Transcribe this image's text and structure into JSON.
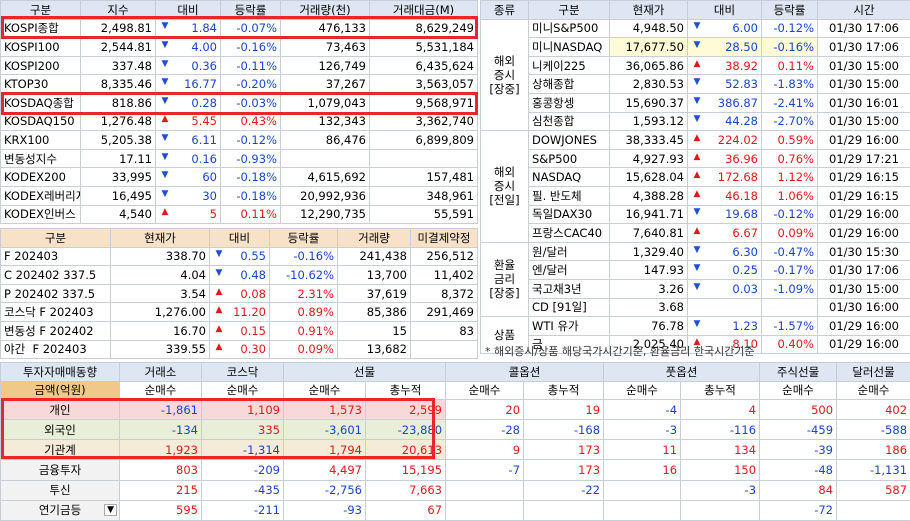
{
  "index_table": {
    "headers": [
      "구분",
      "지수",
      "대비",
      "등락률",
      "거래량(천)",
      "거래대금(M)"
    ],
    "rows": [
      {
        "name": "KOSPI종합",
        "value": "2,498.81",
        "dir": "dn",
        "change": "1.84",
        "rate": "-0.07%",
        "vol": "476,133",
        "amt": "8,629,249"
      },
      {
        "name": "KOSPI100",
        "value": "2,544.81",
        "dir": "dn",
        "change": "4.00",
        "rate": "-0.16%",
        "vol": "73,463",
        "amt": "5,531,184"
      },
      {
        "name": "KOSPI200",
        "value": "337.48",
        "dir": "dn",
        "change": "0.36",
        "rate": "-0.11%",
        "vol": "126,749",
        "amt": "6,435,624"
      },
      {
        "name": "KTOP30",
        "value": "8,335.46",
        "dir": "dn",
        "change": "16.77",
        "rate": "-0.20%",
        "vol": "37,267",
        "amt": "3,563,057"
      },
      {
        "name": "KOSDAQ종합",
        "value": "818.86",
        "dir": "dn",
        "change": "0.28",
        "rate": "-0.03%",
        "vol": "1,079,043",
        "amt": "9,568,971"
      },
      {
        "name": "KOSDAQ150",
        "value": "1,276.48",
        "dir": "up",
        "change": "5.45",
        "rate": "0.43%",
        "vol": "132,343",
        "amt": "3,362,740"
      },
      {
        "name": "KRX100",
        "value": "5,205.38",
        "dir": "dn",
        "change": "6.11",
        "rate": "-0.12%",
        "vol": "86,476",
        "amt": "6,899,809"
      },
      {
        "name": "변동성지수",
        "value": "17.11",
        "dir": "dn",
        "change": "0.16",
        "rate": "-0.93%",
        "vol": "",
        "amt": ""
      },
      {
        "name": "KODEX200",
        "value": "33,995",
        "dir": "dn",
        "change": "60",
        "rate": "-0.18%",
        "vol": "4,615,692",
        "amt": "157,481"
      },
      {
        "name": "KODEX레버리지",
        "value": "16,495",
        "dir": "dn",
        "change": "30",
        "rate": "-0.18%",
        "vol": "20,992,936",
        "amt": "348,961"
      },
      {
        "name": "KODEX인버스",
        "value": "4,540",
        "dir": "up",
        "change": "5",
        "rate": "0.11%",
        "vol": "12,290,735",
        "amt": "55,591"
      }
    ]
  },
  "futures_table": {
    "headers": [
      "구분",
      "현재가",
      "대비",
      "등락률",
      "거래량",
      "미결제약정"
    ],
    "rows": [
      {
        "name": "F 202403",
        "value": "338.70",
        "dir": "dn",
        "change": "0.55",
        "rate": "-0.16%",
        "vol": "241,438",
        "oi": "256,512"
      },
      {
        "name": "C 202402 337.5",
        "value": "4.04",
        "dir": "dn",
        "change": "0.48",
        "rate": "-10.62%",
        "vol": "13,700",
        "oi": "11,402"
      },
      {
        "name": "P 202402 337.5",
        "value": "3.54",
        "dir": "up",
        "change": "0.08",
        "rate": "2.31%",
        "vol": "37,619",
        "oi": "8,372"
      },
      {
        "name": "코스닥 F 202403",
        "value": "1,276.00",
        "dir": "up",
        "change": "11.20",
        "rate": "0.89%",
        "vol": "85,386",
        "oi": "291,469"
      },
      {
        "name": "변동성 F 202402",
        "value": "16.70",
        "dir": "up",
        "change": "0.15",
        "rate": "0.91%",
        "vol": "15",
        "oi": "83"
      },
      {
        "name": "야간  F 202403",
        "value": "339.55",
        "dir": "up",
        "change": "0.30",
        "rate": "0.09%",
        "vol": "13,682",
        "oi": ""
      }
    ]
  },
  "global_table": {
    "headers": [
      "종류",
      "구분",
      "현재가",
      "대비",
      "등락률",
      "시간"
    ],
    "groups": [
      {
        "label": "해외\n증시\n[장중]",
        "rows": [
          {
            "name": "미니S&P500",
            "value": "4,948.50",
            "dir": "dn",
            "change": "6.00",
            "rate": "-0.12%",
            "time": "01/30 17:06",
            "hl": false
          },
          {
            "name": "미니NASDAQ",
            "value": "17,677.50",
            "dir": "dn",
            "change": "28.50",
            "rate": "-0.16%",
            "time": "01/30 17:06",
            "hl": true
          },
          {
            "name": "니케이225",
            "value": "36,065.86",
            "dir": "up",
            "change": "38.92",
            "rate": "0.11%",
            "time": "01/30 15:00",
            "hl": false
          },
          {
            "name": "상해종합",
            "value": "2,830.53",
            "dir": "dn",
            "change": "52.83",
            "rate": "-1.83%",
            "time": "01/30 15:00",
            "hl": false
          },
          {
            "name": "홍콩항셍",
            "value": "15,690.37",
            "dir": "dn",
            "change": "386.87",
            "rate": "-2.41%",
            "time": "01/30 16:01",
            "hl": false
          },
          {
            "name": "심천종합",
            "value": "1,593.12",
            "dir": "dn",
            "change": "44.28",
            "rate": "-2.70%",
            "time": "01/30 15:00",
            "hl": false
          }
        ]
      },
      {
        "label": "해외\n증시\n[전일]",
        "rows": [
          {
            "name": "DOWJONES",
            "value": "38,333.45",
            "dir": "up",
            "change": "224.02",
            "rate": "0.59%",
            "time": "01/29 16:00",
            "hl": false
          },
          {
            "name": "S&P500",
            "value": "4,927.93",
            "dir": "up",
            "change": "36.96",
            "rate": "0.76%",
            "time": "01/29 17:21",
            "hl": false
          },
          {
            "name": "NASDAQ",
            "value": "15,628.04",
            "dir": "up",
            "change": "172.68",
            "rate": "1.12%",
            "time": "01/29 16:15",
            "hl": false
          },
          {
            "name": "필. 반도체",
            "value": "4,388.28",
            "dir": "up",
            "change": "46.18",
            "rate": "1.06%",
            "time": "01/29 16:15",
            "hl": false
          },
          {
            "name": "독일DAX30",
            "value": "16,941.71",
            "dir": "dn",
            "change": "19.68",
            "rate": "-0.12%",
            "time": "01/29 16:00",
            "hl": false
          },
          {
            "name": "프랑스CAC40",
            "value": "7,640.81",
            "dir": "up",
            "change": "6.67",
            "rate": "0.09%",
            "time": "01/29 16:00",
            "hl": false
          }
        ]
      },
      {
        "label": "환율\n금리\n[장중]",
        "rows": [
          {
            "name": "원/달러",
            "value": "1,329.40",
            "dir": "dn",
            "change": "6.30",
            "rate": "-0.47%",
            "time": "01/30 15:30",
            "hl": false
          },
          {
            "name": "엔/달러",
            "value": "147.93",
            "dir": "dn",
            "change": "0.25",
            "rate": "-0.17%",
            "time": "01/30 17:06",
            "hl": false
          },
          {
            "name": "국고채3년",
            "value": "3.26",
            "dir": "dn",
            "change": "0.03",
            "rate": "-1.09%",
            "time": "01/30 15:00",
            "hl": false
          },
          {
            "name": "CD [91일]",
            "value": "3.68",
            "dir": "",
            "change": "",
            "rate": "",
            "time": "01/30 16:00",
            "hl": false
          }
        ]
      },
      {
        "label": "상품",
        "rows": [
          {
            "name": "WTI 유가",
            "value": "76.78",
            "dir": "dn",
            "change": "1.23",
            "rate": "-1.57%",
            "time": "01/29 16:00",
            "hl": false
          },
          {
            "name": "금",
            "value": "2,025.40",
            "dir": "up",
            "change": "8.10",
            "rate": "0.40%",
            "time": "01/29 16:00",
            "hl": false
          }
        ]
      }
    ]
  },
  "note": "* 해외증시/상품 해당국가시간기준, 환율금리 한국시간기준",
  "investor_table": {
    "title": "투자자매매동향",
    "unit": "금액(억원)",
    "groups": [
      "거래소",
      "코스닥",
      "선물",
      "콜옵션",
      "풋옵션",
      "주식선물",
      "달러선물"
    ],
    "subheaders": [
      "순매수",
      "순매수",
      "순매수",
      "총누적",
      "순매수",
      "총누적",
      "순매수",
      "총누적",
      "순매수",
      "순매수"
    ],
    "rows": [
      {
        "name": "개인",
        "cls": "pink",
        "vals": [
          "-1,861",
          "1,109",
          "1,573",
          "2,599",
          "20",
          "19",
          "-4",
          "4",
          "500",
          "402"
        ]
      },
      {
        "name": "외국인",
        "cls": "green",
        "vals": [
          "-134",
          "335",
          "-3,601",
          "-23,880",
          "-28",
          "-168",
          "-3",
          "-116",
          "-459",
          "-588"
        ]
      },
      {
        "name": "기관계",
        "cls": "beige",
        "vals": [
          "1,923",
          "-1,314",
          "1,794",
          "20,613",
          "9",
          "173",
          "11",
          "134",
          "-39",
          "186"
        ]
      },
      {
        "name": "금융투자",
        "cls": "",
        "vals": [
          "803",
          "-209",
          "4,497",
          "15,195",
          "-7",
          "173",
          "16",
          "150",
          "-48",
          "-1,131"
        ]
      },
      {
        "name": "투신",
        "cls": "",
        "vals": [
          "215",
          "-435",
          "-2,756",
          "7,663",
          "",
          "-22",
          "",
          "-3",
          "84",
          "587"
        ]
      },
      {
        "name": "연기금등",
        "cls": "",
        "vals": [
          "595",
          "-211",
          "-93",
          "67",
          "",
          "",
          "",
          "",
          "-72",
          ""
        ]
      }
    ]
  }
}
